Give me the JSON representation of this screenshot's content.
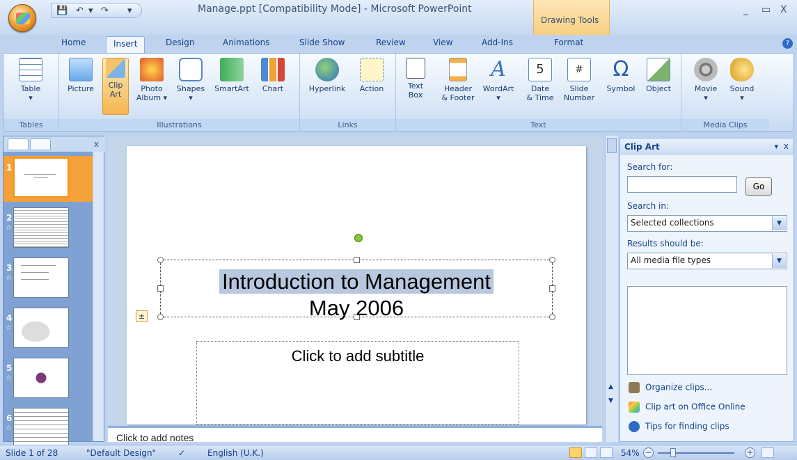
{
  "window": {
    "title": "Manage.ppt [Compatibility Mode] - Microsoft PowerPoint",
    "context_group": "Drawing Tools",
    "minimize": "_",
    "maximize": "▭",
    "close": "X"
  },
  "tabs": [
    "Home",
    "Insert",
    "Design",
    "Animations",
    "Slide Show",
    "Review",
    "View",
    "Add-Ins",
    "Format"
  ],
  "active_tab": "Insert",
  "ribbon": {
    "groups": {
      "tables": "Tables",
      "illustrations": "Illustrations",
      "links": "Links",
      "text": "Text",
      "media": "Media Clips"
    },
    "buttons": {
      "table": "Table",
      "picture": "Picture",
      "clip_art_1": "Clip",
      "clip_art_2": "Art",
      "photo_album_1": "Photo",
      "photo_album_2": "Album",
      "shapes": "Shapes",
      "smartart": "SmartArt",
      "chart": "Chart",
      "hyperlink": "Hyperlink",
      "action": "Action",
      "text_box_1": "Text",
      "text_box_2": "Box",
      "header_footer_1": "Header",
      "header_footer_2": "& Footer",
      "wordart": "WordArt",
      "date_time_1": "Date",
      "date_time_2": "& Time",
      "slide_number_1": "Slide",
      "slide_number_2": "Number",
      "symbol": "Symbol",
      "object": "Object",
      "movie": "Movie",
      "sound": "Sound"
    }
  },
  "slides_pane": {
    "numbers": [
      "1",
      "2",
      "3",
      "4",
      "5",
      "6"
    ],
    "close": "x"
  },
  "slide": {
    "title_line1": "Introduction to Management",
    "title_line2": "May 2006",
    "subtitle_placeholder": "Click to add subtitle",
    "autofit_icon": "±"
  },
  "notes_placeholder": "Click to add notes",
  "task_pane": {
    "title": "Clip Art",
    "search_for_label": "Search for:",
    "search_value": "",
    "go_button": "Go",
    "search_in_label": "Search in:",
    "search_in_value": "Selected collections",
    "results_label": "Results should be:",
    "results_value": "All media file types",
    "links": [
      "Organize clips...",
      "Clip art on Office Online",
      "Tips for finding clips"
    ]
  },
  "status": {
    "slide_of": "Slide 1 of 28",
    "theme": "\"Default Design\"",
    "language": "English (U.K.)",
    "zoom": "54%"
  }
}
